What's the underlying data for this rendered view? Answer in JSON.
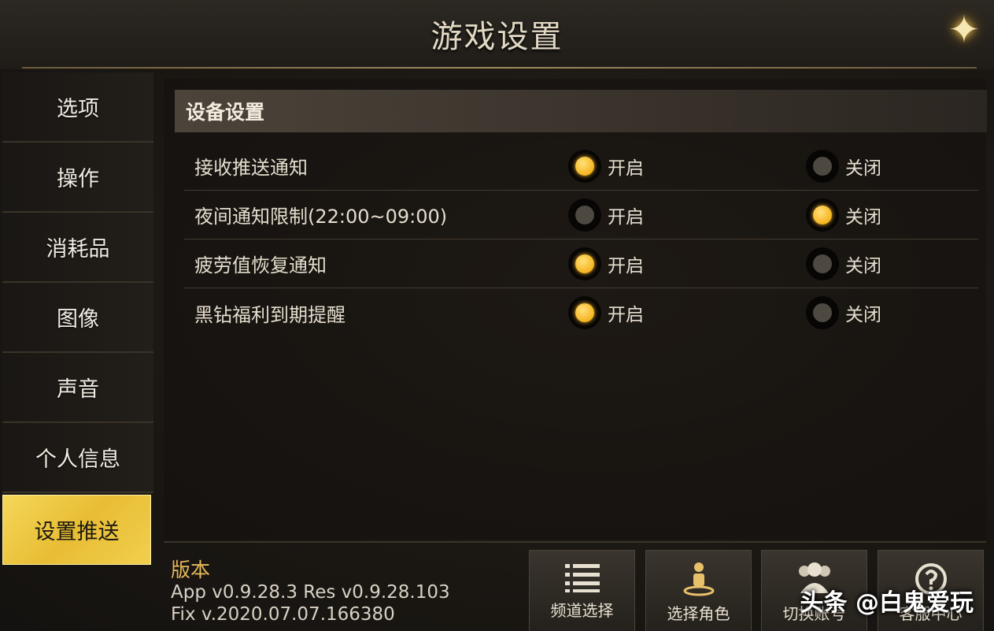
{
  "header": {
    "title": "游戏设置"
  },
  "sidebar": {
    "items": [
      {
        "label": "选项"
      },
      {
        "label": "操作"
      },
      {
        "label": "消耗品"
      },
      {
        "label": "图像"
      },
      {
        "label": "声音"
      },
      {
        "label": "个人信息"
      },
      {
        "label": "设置推送"
      }
    ],
    "active_label": "设置推送"
  },
  "section": {
    "title": "设备设置"
  },
  "settings": [
    {
      "label": "接收推送通知",
      "on_label": "开启",
      "off_label": "关闭",
      "value": "on"
    },
    {
      "label": "夜间通知限制(22:00~09:00)",
      "on_label": "开启",
      "off_label": "关闭",
      "value": "off"
    },
    {
      "label": "疲劳值恢复通知",
      "on_label": "开启",
      "off_label": "关闭",
      "value": "on"
    },
    {
      "label": "黑钻福利到期提醒",
      "on_label": "开启",
      "off_label": "关闭",
      "value": "on"
    }
  ],
  "version": {
    "title": "版本",
    "line1": "App v0.9.28.3 Res v0.9.28.103",
    "line2": "Fix v.2020.07.07.166380"
  },
  "footer_buttons": [
    {
      "label": "频道选择",
      "icon": "list-icon"
    },
    {
      "label": "选择角色",
      "icon": "character-icon"
    },
    {
      "label": "切换账号",
      "icon": "users-icon"
    },
    {
      "label": "客服中心",
      "icon": "support-icon"
    }
  ],
  "watermark": "头条 @白鬼爱玩",
  "colors": {
    "accent": "#f5b41e",
    "active_tab": "#f0c944",
    "version_title": "#e7b95a"
  }
}
